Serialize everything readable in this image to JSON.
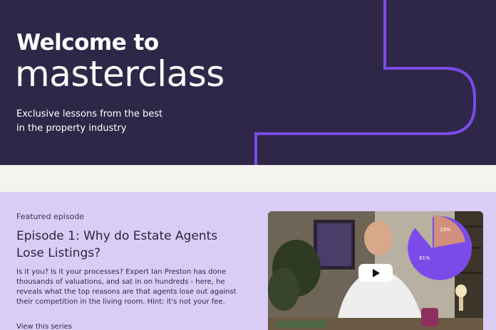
{
  "hero": {
    "title_line1": "Welcome to",
    "title_line2": "masterclass",
    "subtitle": "Exclusive lessons from the best in the property industry",
    "background_color": "#2e2748",
    "accent_color": "#7b4bea"
  },
  "featured": {
    "label": "Featured episode",
    "title": "Episode 1: Why do Estate Agents Lose Listings?",
    "description": "Is it you? Is it your processes? Expert Ian Preston has done thousands of valuations, and sat in on hundreds - here, he reveals what the top reasons are that agents lose out against their competition in the living room. Hint: it's not your fee.",
    "link_label": "View this series",
    "background_color": "#d9cdf6"
  },
  "video": {
    "play_icon": "play-icon",
    "pie": {
      "slices": [
        {
          "label": "81%",
          "value": 81,
          "color": "#7b4bea"
        },
        {
          "label": "19%",
          "value": 19,
          "color": "#d28f7d"
        }
      ]
    }
  }
}
